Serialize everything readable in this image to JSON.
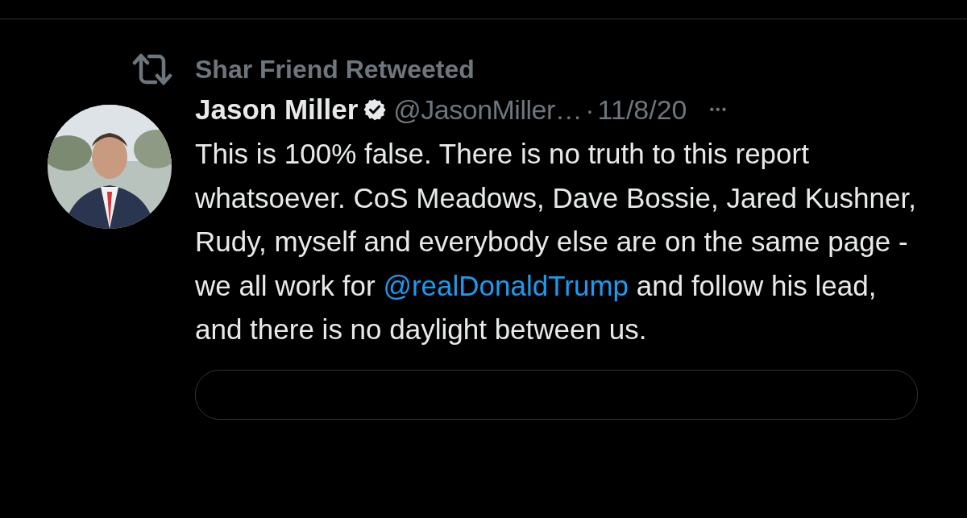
{
  "retweet_banner": {
    "label": "Shar Friend Retweeted"
  },
  "tweet": {
    "author": {
      "name": "Jason Miller",
      "verified": true,
      "handle": "@JasonMiller…",
      "kind": "picture"
    },
    "separator": "·",
    "date": "11/8/20",
    "more": "•••",
    "text_before": "This is 100% false. There is no truth to this report whatsoever. CoS Meadows, Dave Bossie, Jared Kushner, Rudy, myself and everybody else are on the same page - we all work for ",
    "mention": "@realDonaldTrump",
    "text_after": " and follow his lead, and there is no daylight between us.",
    "quoted_card": {
      "kind": "card"
    }
  }
}
